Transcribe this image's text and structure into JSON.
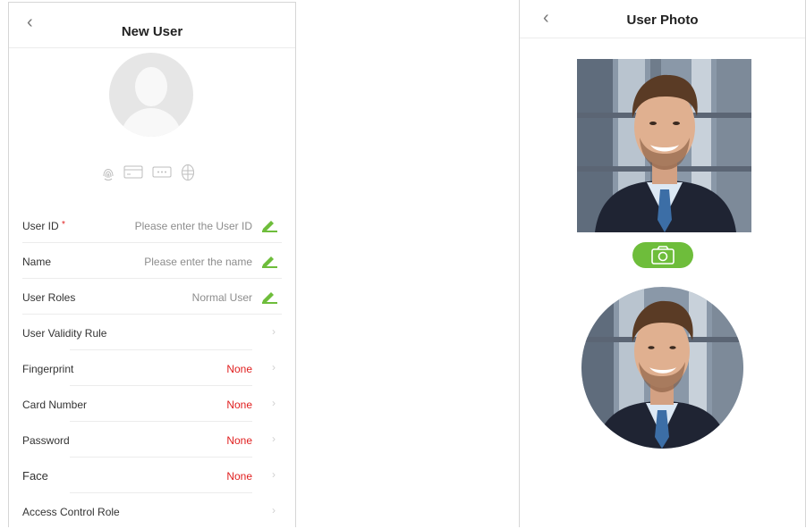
{
  "new_user": {
    "back_symbol": "‹",
    "title": "New User",
    "credential_icons": [
      "fingerprint-icon",
      "card-icon",
      "password-icon",
      "face-icon"
    ],
    "rows": [
      {
        "label": "User ID",
        "required_mark": "*",
        "value": "Please enter the User ID"
      },
      {
        "label": "Name",
        "value": "Please enter the name"
      },
      {
        "label": "User Roles",
        "value": "Normal User"
      },
      {
        "label": "User Validity Rule"
      },
      {
        "label": "Fingerprint",
        "value": "None"
      },
      {
        "label": "Card Number",
        "value": "None"
      },
      {
        "label": "Password",
        "value": "None"
      },
      {
        "label": "Face",
        "value": "None"
      },
      {
        "label": "Access Control Role"
      }
    ]
  },
  "user_photo": {
    "back_symbol": "‹",
    "title": "User Photo"
  },
  "colors": {
    "accent_green": "#6ebd3b",
    "none_red": "#e02020",
    "suit": "#1f2433",
    "shirt": "#dce8f4",
    "tie": "#3c6ea6"
  }
}
